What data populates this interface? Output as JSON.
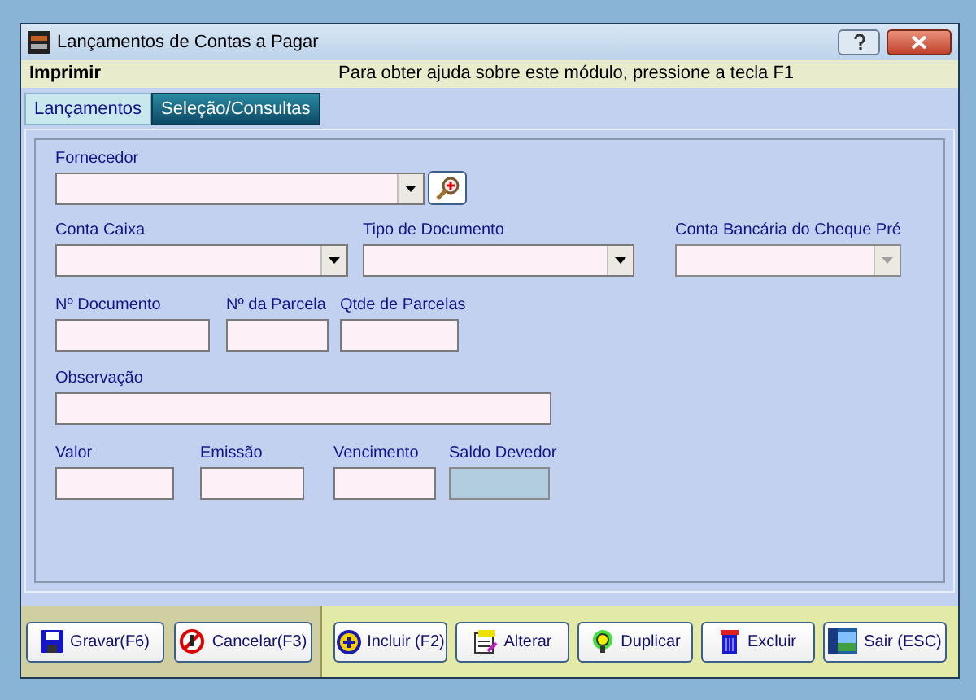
{
  "window": {
    "title": "Lançamentos de Contas a Pagar"
  },
  "menu": {
    "label": "Imprimir"
  },
  "help_text": "Para obter ajuda sobre este módulo, pressione a tecla F1",
  "tabs": [
    {
      "label": "Lançamentos",
      "selected": true
    },
    {
      "label": "Seleção/Consultas",
      "selected": false
    }
  ],
  "form_rows": [
    [
      {
        "label": "Fornecedor",
        "kind": "combo",
        "disabled": false
      }
    ],
    [
      {
        "label": "Conta Caixa",
        "kind": "combo",
        "disabled": false
      },
      {
        "label": "Tipo de Documento",
        "kind": "combo",
        "disabled": false
      },
      {
        "label": "Conta Bancária do Cheque Pré",
        "kind": "combo",
        "disabled": true
      }
    ],
    [
      {
        "label": "Nº Documento",
        "kind": "text",
        "disabled": false
      },
      {
        "label": "Nº da Parcela",
        "kind": "text",
        "disabled": false
      },
      {
        "label": "Qtde de Parcelas",
        "kind": "text",
        "disabled": false
      }
    ],
    [
      {
        "label": "Observação",
        "kind": "text",
        "disabled": false
      }
    ],
    [
      {
        "label": "Valor",
        "kind": "text",
        "disabled": false
      },
      {
        "label": "Emissão",
        "kind": "text",
        "disabled": false
      },
      {
        "label": "Vencimento",
        "kind": "text",
        "disabled": false
      },
      {
        "label": "Saldo Devedor",
        "kind": "text",
        "disabled": true
      }
    ]
  ],
  "left_buttons": [
    "Gravar(F6)",
    "Cancelar(F3)"
  ],
  "right_buttons": [
    "Incluir (F2)",
    "Alterar",
    "Duplicar",
    "Excluir",
    "Sair (ESC)"
  ]
}
